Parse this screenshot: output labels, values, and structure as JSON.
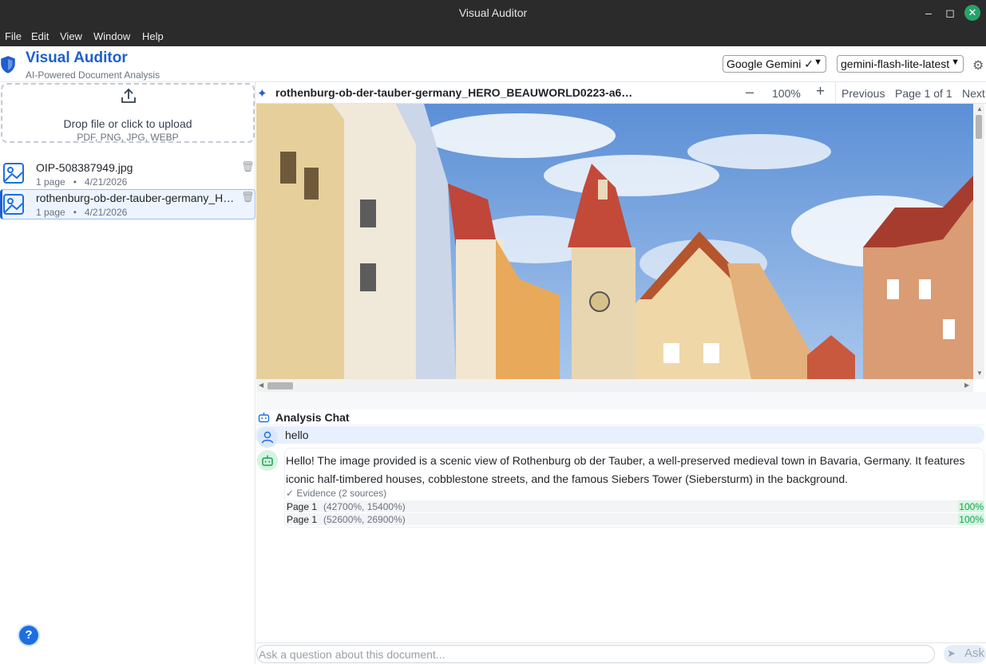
{
  "window": {
    "title": "Visual Auditor"
  },
  "menu": [
    "File",
    "Edit",
    "View",
    "Window",
    "Help"
  ],
  "header": {
    "title": "Visual Auditor",
    "subtitle": "AI-Powered Document Analysis",
    "provider": "Google Gemini ✓",
    "model": "gemini-flash-lite-latest"
  },
  "upload": {
    "label": "Drop file or click to upload",
    "types": "PDF, PNG, JPG, WEBP"
  },
  "files": [
    {
      "name": "OIP-508387949.jpg",
      "meta": "1 page   •   4/21/2026"
    },
    {
      "name": "rothenburg-ob-der-tauber-germany_HERO_BEAUWORLD0223-a6",
      "meta": "1 page   •   4/21/2026"
    }
  ],
  "viewer": {
    "filename": "rothenburg-ob-der-tauber-germany_HERO_BEAUWORLD0223-a6…",
    "zoom": "100%",
    "prev": "Previous",
    "page": "Page 1 of 1",
    "next": "Next"
  },
  "chat": {
    "title": "Analysis Chat",
    "user_message": "hello",
    "assistant_message": "Hello! The image provided is a scenic view of Rothenburg ob der Tauber, a well-preserved medieval town in Bavaria, Germany. It features iconic half-timbered houses, cobblestone streets, and the famous Siebers Tower (Siebersturm) in the background.",
    "evidence": "Evidence (2 sources)",
    "sources": [
      {
        "page": "Page 1",
        "coords": "(42700%, 15400%)",
        "confidence": "100%"
      },
      {
        "page": "Page 1",
        "coords": "(52600%, 26900%)",
        "confidence": "100%"
      }
    ],
    "input_placeholder": "Ask a question about this document...",
    "ask": "Ask"
  },
  "help": "?",
  "colors": {
    "accent": "#1d5fd0",
    "confidence": "#16a34a",
    "titlebar": "#2b2b2b"
  }
}
